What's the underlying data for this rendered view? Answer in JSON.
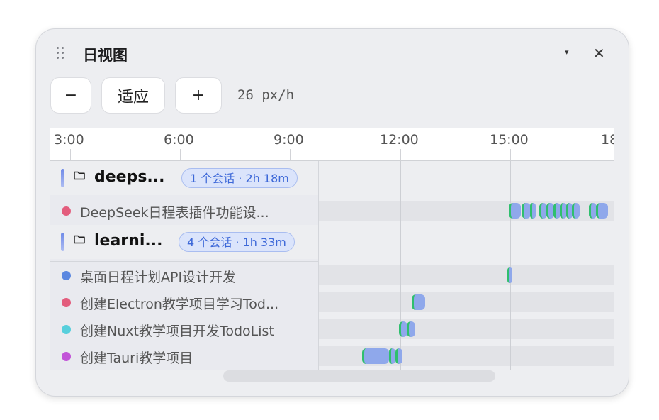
{
  "window": {
    "title": "日视图",
    "dropdown_glyph": "▾",
    "close_glyph": "✕"
  },
  "toolbar": {
    "zoom_out": "−",
    "fit": "适应",
    "zoom_in": "+",
    "zoom_level": "26 px/h"
  },
  "ruler": {
    "ticks": [
      "3:00",
      "6:00",
      "9:00",
      "12:00",
      "15:00",
      "18"
    ]
  },
  "groups": [
    {
      "name": "deeps...",
      "badge": "1 个会话 · 2h 18m",
      "sessions": [
        {
          "title": "DeepSeek日程表插件功能设...",
          "color": "#e35d7d"
        }
      ]
    },
    {
      "name": "learni...",
      "badge": "4 个会话 · 1h 33m",
      "sessions": [
        {
          "title": "桌面日程计划API设计开发",
          "color": "#5b87e0"
        },
        {
          "title": "创建Electron教学项目学习Tod...",
          "color": "#e35d7d"
        },
        {
          "title": "创建Nuxt教学项目开发TodoList",
          "color": "#57cfdc"
        },
        {
          "title": "创建Tauri教学项目",
          "color": "#c254d8"
        }
      ]
    }
  ],
  "colors": {
    "segment_blue": "#8fa8eb",
    "segment_green": "#2fbf6e",
    "badge_text": "#3d68d8"
  },
  "icons": {
    "handle": "grip-dots-icon",
    "folder": "folder-icon",
    "close": "close-icon",
    "dropdown": "chevron-down-icon"
  }
}
